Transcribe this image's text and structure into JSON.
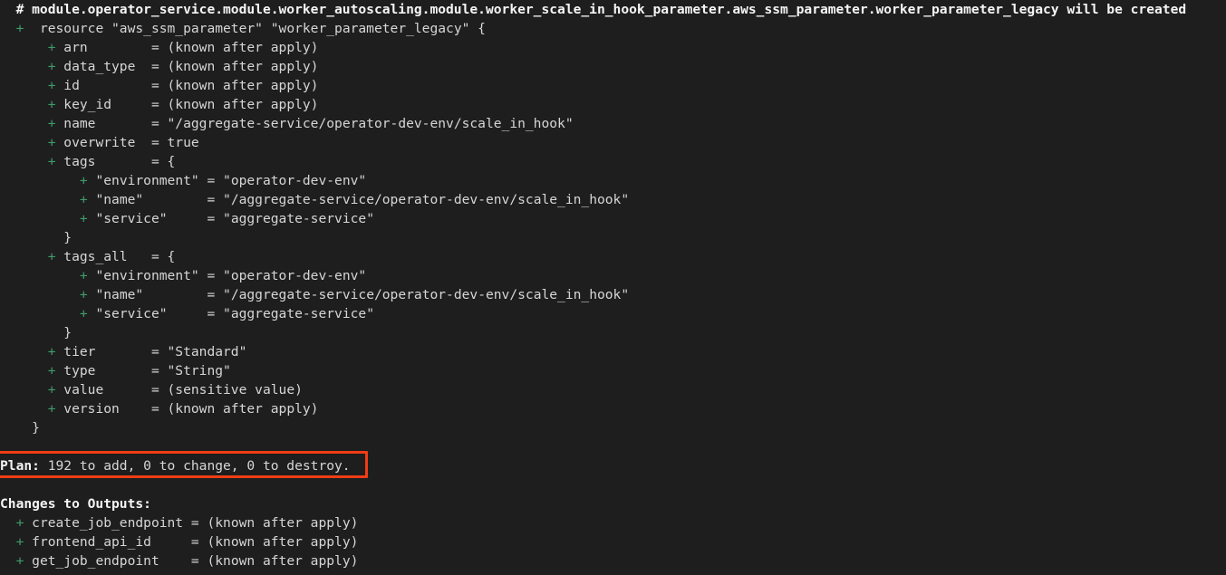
{
  "terminal": {
    "background_color": "#1e1e1e",
    "foreground_color": "#d6d6d6",
    "add_marker_color": "#3f9c69",
    "annotation_color": "#f03c15",
    "title": "terraform plan output"
  },
  "resource_header": {
    "comment_line": "  # module.operator_service.module.worker_autoscaling.module.worker_scale_in_hook_parameter.aws_ssm_parameter.worker_parameter_legacy will be created",
    "resource_line_marker": "+",
    "resource_line_text": " resource \"aws_ssm_parameter\" \"worker_parameter_legacy\" {",
    "resource_type": "aws_ssm_parameter",
    "resource_name": "worker_parameter_legacy",
    "action": "will be created"
  },
  "attributes": [
    {
      "indent": "      ",
      "marker": "+",
      "text": " arn        = (known after apply)",
      "key": "arn",
      "value": "(known after apply)"
    },
    {
      "indent": "      ",
      "marker": "+",
      "text": " data_type  = (known after apply)",
      "key": "data_type",
      "value": "(known after apply)"
    },
    {
      "indent": "      ",
      "marker": "+",
      "text": " id         = (known after apply)",
      "key": "id",
      "value": "(known after apply)"
    },
    {
      "indent": "      ",
      "marker": "+",
      "text": " key_id     = (known after apply)",
      "key": "key_id",
      "value": "(known after apply)"
    },
    {
      "indent": "      ",
      "marker": "+",
      "text": " name       = \"/aggregate-service/operator-dev-env/scale_in_hook\"",
      "key": "name",
      "value": "/aggregate-service/operator-dev-env/scale_in_hook"
    },
    {
      "indent": "      ",
      "marker": "+",
      "text": " overwrite  = true",
      "key": "overwrite",
      "value": "true"
    },
    {
      "indent": "      ",
      "marker": "+",
      "text": " tags       = {",
      "key": "tags",
      "value": "{"
    },
    {
      "indent": "          ",
      "marker": "+",
      "text": " \"environment\" = \"operator-dev-env\"",
      "key": "environment",
      "value": "operator-dev-env"
    },
    {
      "indent": "          ",
      "marker": "+",
      "text": " \"name\"        = \"/aggregate-service/operator-dev-env/scale_in_hook\"",
      "key": "name",
      "value": "/aggregate-service/operator-dev-env/scale_in_hook"
    },
    {
      "indent": "          ",
      "marker": "+",
      "text": " \"service\"     = \"aggregate-service\"",
      "key": "service",
      "value": "aggregate-service"
    },
    {
      "indent": "        ",
      "marker": "",
      "text": "}",
      "key": "",
      "value": "}"
    },
    {
      "indent": "      ",
      "marker": "+",
      "text": " tags_all   = {",
      "key": "tags_all",
      "value": "{"
    },
    {
      "indent": "          ",
      "marker": "+",
      "text": " \"environment\" = \"operator-dev-env\"",
      "key": "environment",
      "value": "operator-dev-env"
    },
    {
      "indent": "          ",
      "marker": "+",
      "text": " \"name\"        = \"/aggregate-service/operator-dev-env/scale_in_hook\"",
      "key": "name",
      "value": "/aggregate-service/operator-dev-env/scale_in_hook"
    },
    {
      "indent": "          ",
      "marker": "+",
      "text": " \"service\"     = \"aggregate-service\"",
      "key": "service",
      "value": "aggregate-service"
    },
    {
      "indent": "        ",
      "marker": "",
      "text": "}",
      "key": "",
      "value": "}"
    },
    {
      "indent": "      ",
      "marker": "+",
      "text": " tier       = \"Standard\"",
      "key": "tier",
      "value": "Standard"
    },
    {
      "indent": "      ",
      "marker": "+",
      "text": " type       = \"String\"",
      "key": "type",
      "value": "String"
    },
    {
      "indent": "      ",
      "marker": "+",
      "text": " value      = (sensitive value)",
      "key": "value",
      "value": "(sensitive value)"
    },
    {
      "indent": "      ",
      "marker": "+",
      "text": " version    = (known after apply)",
      "key": "version",
      "value": "(known after apply)"
    },
    {
      "indent": "    ",
      "marker": "",
      "text": "}",
      "key": "",
      "value": "}"
    }
  ],
  "plan_summary": {
    "label": "Plan:",
    "text": " 192 to add, 0 to change, 0 to destroy.",
    "to_add": 192,
    "to_change": 0,
    "to_destroy": 0,
    "highlighted": true
  },
  "changes_to_outputs": {
    "heading": "Changes to Outputs:",
    "items": [
      {
        "indent": "  ",
        "marker": "+",
        "text": " create_job_endpoint = (known after apply)",
        "key": "create_job_endpoint",
        "value": "(known after apply)"
      },
      {
        "indent": "  ",
        "marker": "+",
        "text": " frontend_api_id     = (known after apply)",
        "key": "frontend_api_id",
        "value": "(known after apply)"
      },
      {
        "indent": "  ",
        "marker": "+",
        "text": " get_job_endpoint    = (known after apply)",
        "key": "get_job_endpoint",
        "value": "(known after apply)"
      }
    ]
  }
}
